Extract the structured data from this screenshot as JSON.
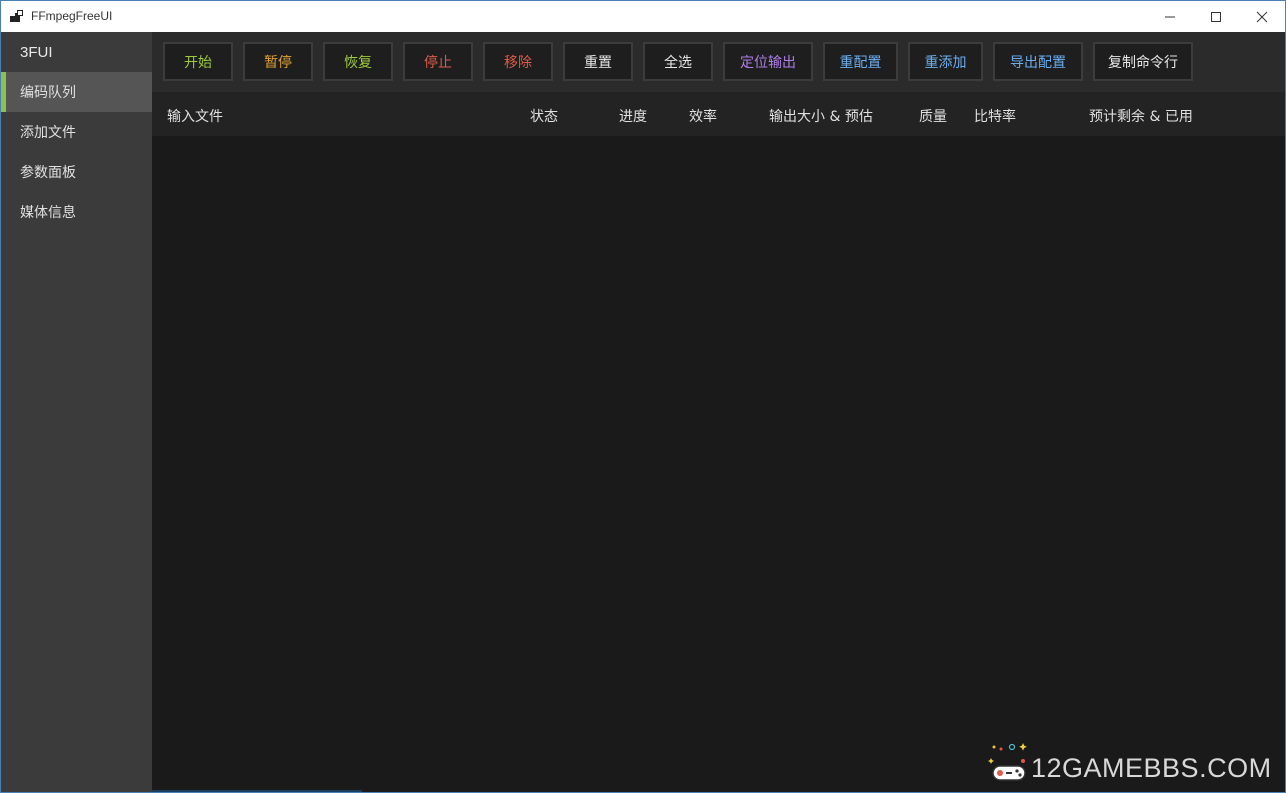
{
  "window": {
    "title": "FFmpegFreeUI"
  },
  "sidebar": {
    "brand": "3FUI",
    "items": [
      {
        "label": "编码队列",
        "active": true
      },
      {
        "label": "添加文件",
        "active": false
      },
      {
        "label": "参数面板",
        "active": false
      },
      {
        "label": "媒体信息",
        "active": false
      }
    ],
    "accent_color": "#8bc34a"
  },
  "toolbar": {
    "buttons": [
      {
        "label": "开始",
        "color": "#9ccc3a"
      },
      {
        "label": "暂停",
        "color": "#e0a030"
      },
      {
        "label": "恢复",
        "color": "#9ccc3a"
      },
      {
        "label": "停止",
        "color": "#e05a4a"
      },
      {
        "label": "移除",
        "color": "#e05a4a"
      },
      {
        "label": "重置",
        "color": "#e8e8e8"
      },
      {
        "label": "全选",
        "color": "#e8e8e8"
      },
      {
        "label": "定位输出",
        "color": "#b07ee8"
      },
      {
        "label": "重配置",
        "color": "#6aaef0"
      },
      {
        "label": "重添加",
        "color": "#6aaef0"
      },
      {
        "label": "导出配置",
        "color": "#6aaef0"
      },
      {
        "label": "复制命令行",
        "color": "#e8e8e8"
      }
    ]
  },
  "table": {
    "columns": [
      "输入文件",
      "状态",
      "进度",
      "效率",
      "输出大小 & 预估",
      "质量",
      "比特率",
      "预计剩余 & 已用"
    ],
    "rows": []
  },
  "watermark": {
    "text": "12GAMEBBS.COM"
  }
}
